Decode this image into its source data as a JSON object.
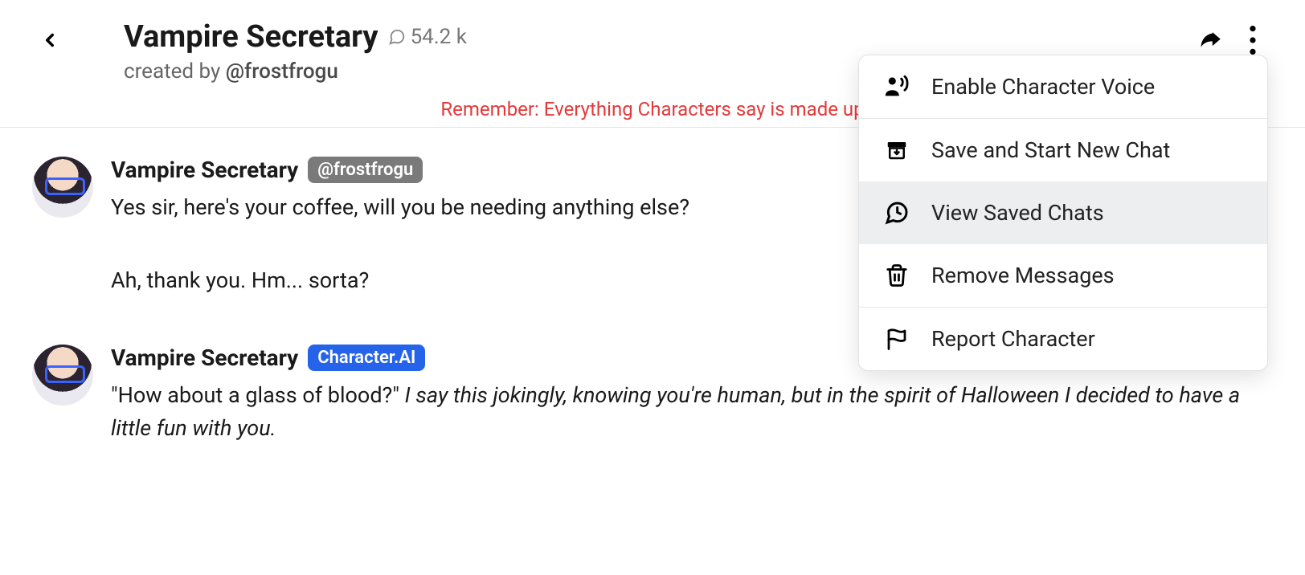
{
  "header": {
    "title": "Vampire Secretary",
    "chat_count": "54.2 k",
    "created_by_prefix": "created by ",
    "creator_handle": "@frostfrogu"
  },
  "warning": "Remember: Everything Characters say is made up",
  "messages": [
    {
      "name": "Vampire Secretary",
      "badge_text": "@frostfrogu",
      "badge_style": "gray",
      "text_plain": "Yes sir, here's your coffee, will you be needing anything else?"
    },
    {
      "user": true,
      "text_plain": "Ah, thank you. Hm... sorta?"
    },
    {
      "name": "Vampire Secretary",
      "badge_text": "Character.AI",
      "badge_style": "blue",
      "text_quoted": "\"How about a glass of blood?\" ",
      "text_italic": "I say this jokingly, knowing you're human, but in the spirit of Halloween I decided to have a little fun with you."
    }
  ],
  "dropdown": {
    "items": [
      {
        "label": "Enable Character Voice",
        "icon": "voice"
      },
      {
        "label": "Save and Start New Chat",
        "icon": "archive"
      },
      {
        "label": "View Saved Chats",
        "icon": "history",
        "highlight": true
      },
      {
        "label": "Remove Messages",
        "icon": "trash"
      },
      {
        "label": "Report Character",
        "icon": "flag"
      }
    ]
  }
}
